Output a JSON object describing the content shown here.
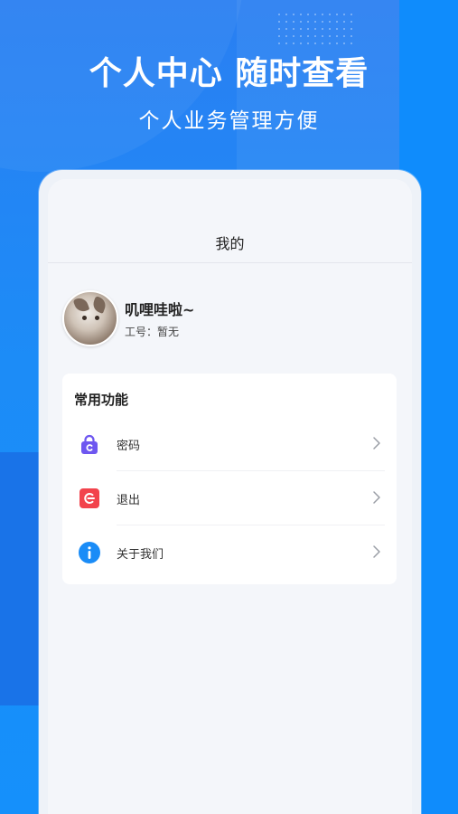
{
  "promo": {
    "headline": "个人中心 随时查看",
    "subline": "个人业务管理方便"
  },
  "navbar": {
    "title": "我的"
  },
  "profile": {
    "name": "叽哩哇啦~",
    "employee_id": "工号：暂无"
  },
  "functions": {
    "title": "常用功能",
    "items": [
      {
        "label": "密码",
        "icon": "lock-icon",
        "color": "#6e57f0"
      },
      {
        "label": "退出",
        "icon": "logout-icon",
        "color": "#f2434c"
      },
      {
        "label": "关于我们",
        "icon": "info-icon",
        "color": "#1a8cf7"
      }
    ]
  },
  "colors": {
    "background": "#2a7ff2",
    "screen": "#f4f6fa",
    "card": "#ffffff"
  }
}
